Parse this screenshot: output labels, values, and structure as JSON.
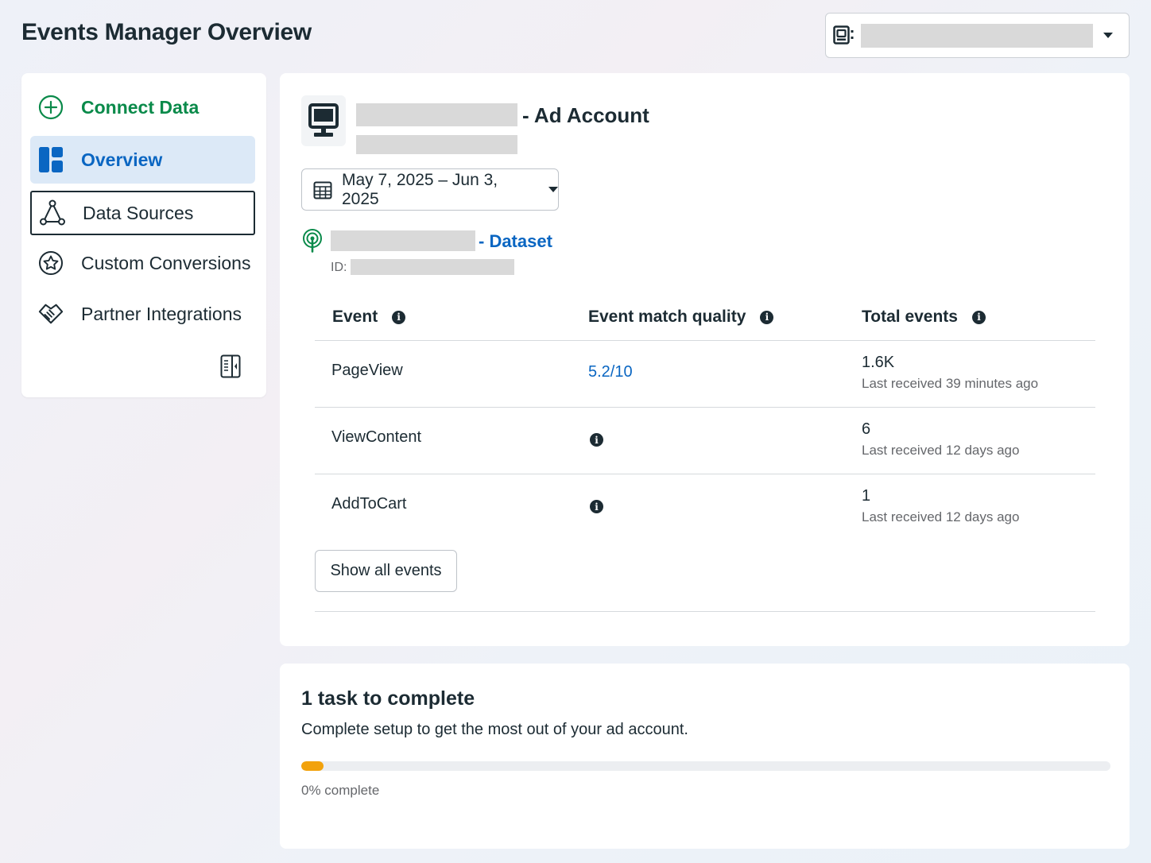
{
  "header": {
    "title": "Events Manager Overview",
    "account_selector": {
      "icon": "business-account-icon",
      "value_redacted": true
    }
  },
  "sidebar": {
    "items": [
      {
        "label": "Connect Data",
        "icon": "plus-circle-icon",
        "state": "accent"
      },
      {
        "label": "Overview",
        "icon": "dashboard-icon",
        "state": "selected"
      },
      {
        "label": "Data Sources",
        "icon": "nodes-icon",
        "state": "focused"
      },
      {
        "label": "Custom Conversions",
        "icon": "star-badge-icon",
        "state": "default"
      },
      {
        "label": "Partner Integrations",
        "icon": "handshake-icon",
        "state": "default"
      }
    ],
    "collapse_icon": "collapse-panel-icon"
  },
  "account": {
    "icon": "desktop-icon",
    "suffix": "- Ad Account"
  },
  "date_range": {
    "label": "May 7, 2025 – Jun 3, 2025",
    "icon": "calendar-icon"
  },
  "dataset": {
    "icon": "signal-icon",
    "suffix": "- Dataset",
    "id_label": "ID:"
  },
  "table": {
    "headers": [
      "Event",
      "Event match quality",
      "Total events"
    ],
    "rows": [
      {
        "event": "PageView",
        "match_quality": "5.2/10",
        "total": "1.6K",
        "last_received": "Last received 39 minutes ago"
      },
      {
        "event": "ViewContent",
        "match_quality": null,
        "total": "6",
        "last_received": "Last received 12 days ago"
      },
      {
        "event": "AddToCart",
        "match_quality": null,
        "total": "1",
        "last_received": "Last received 12 days ago"
      }
    ],
    "show_all_label": "Show all events"
  },
  "tasks": {
    "title": "1 task to complete",
    "subtitle": "Complete setup to get the most out of your ad account.",
    "progress_percent": 0,
    "progress_label": "0% complete"
  },
  "colors": {
    "accent_green": "#0a8a4a",
    "link_blue": "#0a66c2",
    "selected_bg": "#dce9f7",
    "progress_orange": "#f2a20c"
  }
}
